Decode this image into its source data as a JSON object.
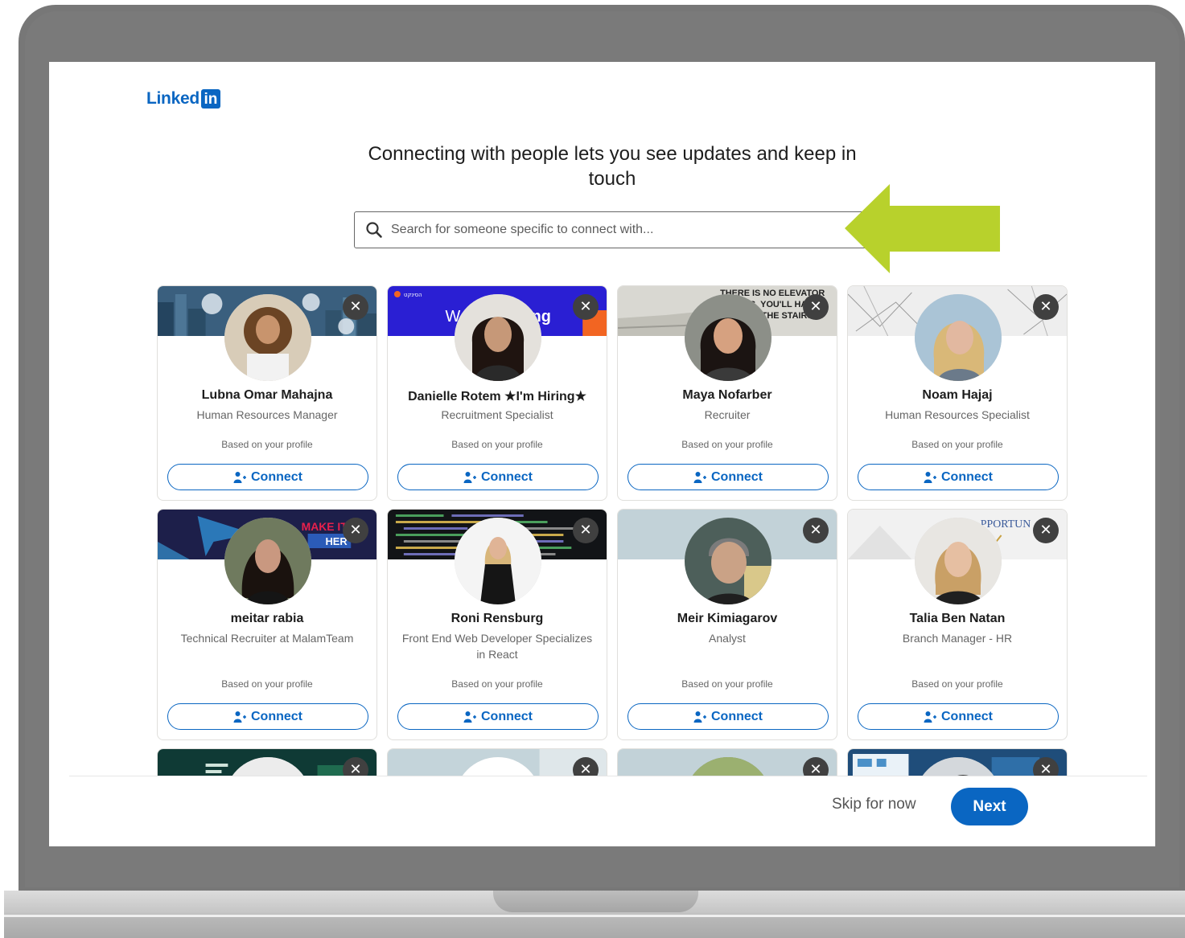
{
  "brand": {
    "logo_text": "Linked",
    "logo_in": "in",
    "color": "#0a66c2"
  },
  "heading": "Connecting with people lets you see updates and keep in touch",
  "search": {
    "placeholder": "Search for someone specific to connect with..."
  },
  "cards": [
    {
      "name": "Lubna Omar Mahajna",
      "headline": "Human Resources Manager",
      "reason": "Based on your profile",
      "connect_label": "Connect"
    },
    {
      "name": "Danielle Rotem ★I'm Hiring★",
      "headline": "Recruitment Specialist",
      "reason": "Based on your profile",
      "connect_label": "Connect"
    },
    {
      "name": "Maya Nofarber",
      "headline": "Recruiter",
      "reason": "Based on your profile",
      "connect_label": "Connect"
    },
    {
      "name": "Noam Hajaj",
      "headline": "Human Resources Specialist",
      "reason": "Based on your profile",
      "connect_label": "Connect"
    },
    {
      "name": "meitar rabia",
      "headline": "Technical Recruiter at MalamTeam",
      "reason": "Based on your profile",
      "connect_label": "Connect"
    },
    {
      "name": "Roni Rensburg",
      "headline": "Front End Web Developer Specializes in React",
      "reason": "Based on your profile",
      "connect_label": "Connect"
    },
    {
      "name": "Meir Kimiagarov",
      "headline": "Analyst",
      "reason": "Based on your profile",
      "connect_label": "Connect"
    },
    {
      "name": "Talia Ben Natan",
      "headline": "Branch Manager - HR",
      "reason": "Based on your profile",
      "connect_label": "Connect"
    }
  ],
  "banner_text": {
    "card2_left": "W",
    "card2_right": "ng",
    "card3": [
      "THERE IS NO ELEVATOR",
      "CES, YOU'LL HAVE",
      "THE STAIRS."
    ],
    "card5": [
      "MAKE IT",
      "HER"
    ],
    "card8": "PPORTUN"
  },
  "dismiss_label": "✕",
  "footer": {
    "skip_label": "Skip for now",
    "next_label": "Next"
  },
  "accent": {
    "arrow": "#b8d12c",
    "primary": "#0a66c2"
  }
}
